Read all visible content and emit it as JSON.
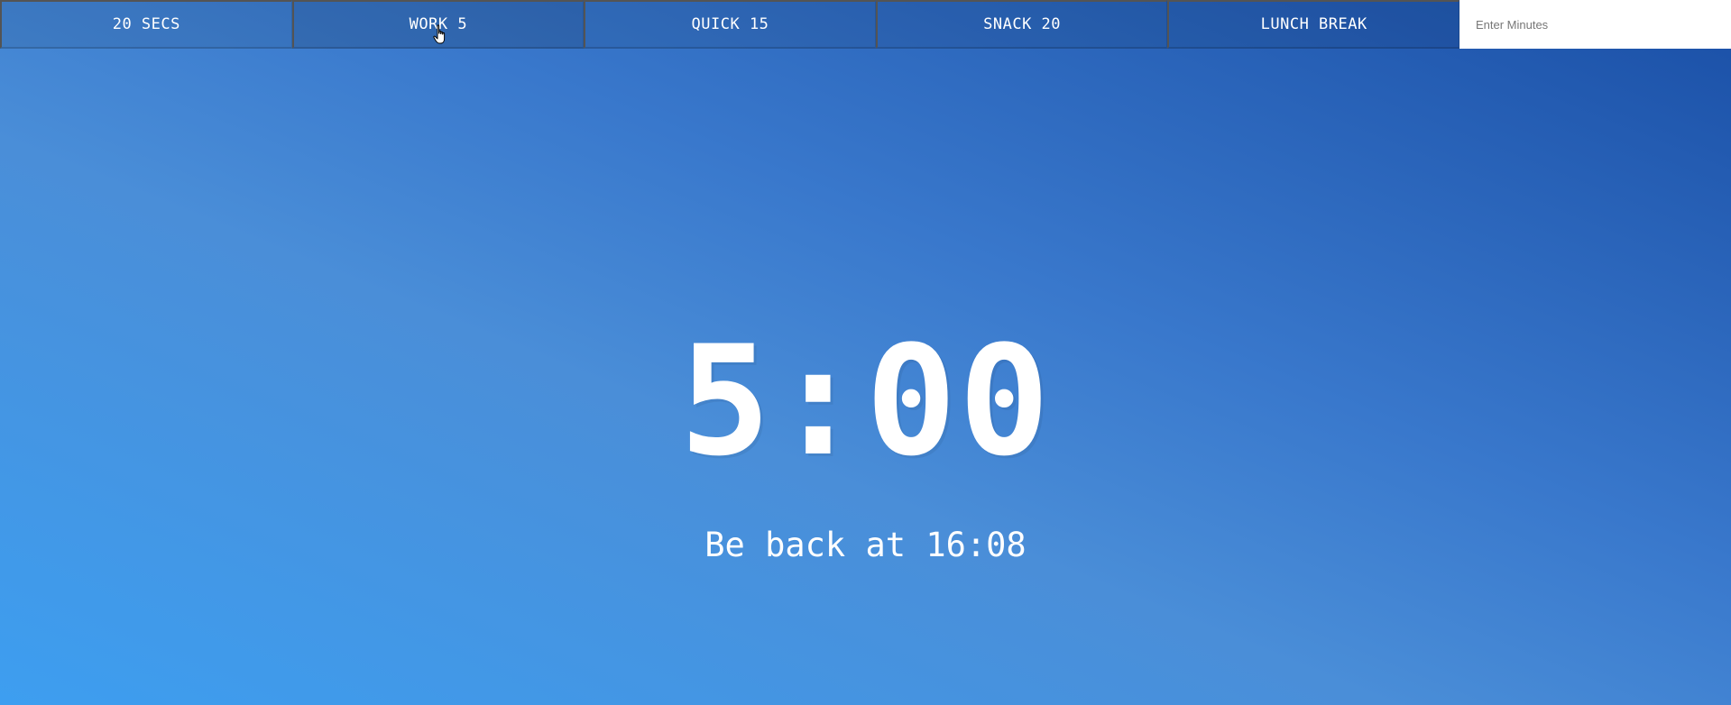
{
  "timer_buttons": [
    {
      "label": "20 SECS"
    },
    {
      "label": "WORK 5"
    },
    {
      "label": "QUICK 15"
    },
    {
      "label": "SNACK 20"
    },
    {
      "label": "LUNCH BREAK"
    }
  ],
  "custom_form": {
    "placeholder": "Enter Minutes",
    "value": ""
  },
  "display": {
    "time_left": "5:00",
    "end_time": "Be back at 16:08"
  },
  "colors": {
    "text": "#ffffff",
    "gradient_start": "#3d9ef0",
    "gradient_end": "#1a4fa6",
    "input_bg": "#ffffff"
  },
  "icons": {
    "cursor": "hand-pointer-icon"
  }
}
